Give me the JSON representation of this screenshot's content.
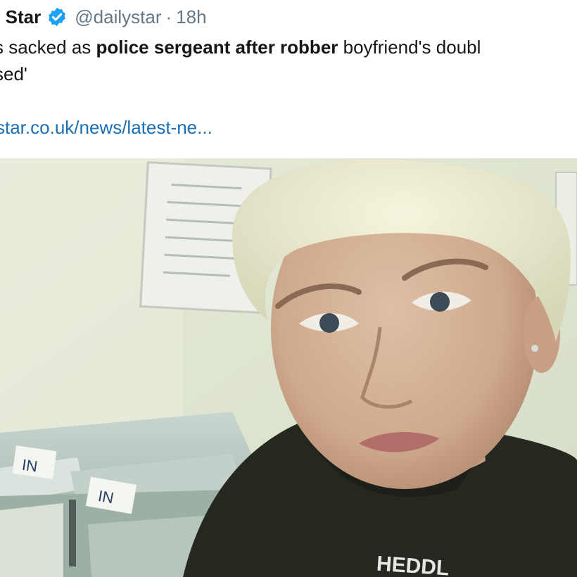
{
  "tweet": {
    "display_name": "y Star",
    "handle": "@dailystar",
    "separator": "·",
    "time": "18h",
    "text_line1_part1": "s sacked as ",
    "text_line1_bold1": "police sergeant after robber",
    "text_line1_part2": " boyfriend's doubl",
    "text_line2": "sed'",
    "link": "star.co.uk/news/latest-ne..."
  },
  "photo": {
    "tray_label_1": "IN",
    "tray_label_2": "IN",
    "hoodie_text": "HEDDL"
  },
  "colors": {
    "verified_badge": "#1da1f2",
    "link": "#1b6fb5",
    "muted": "#657786"
  },
  "icons": {
    "verified": "verified-badge-icon"
  }
}
